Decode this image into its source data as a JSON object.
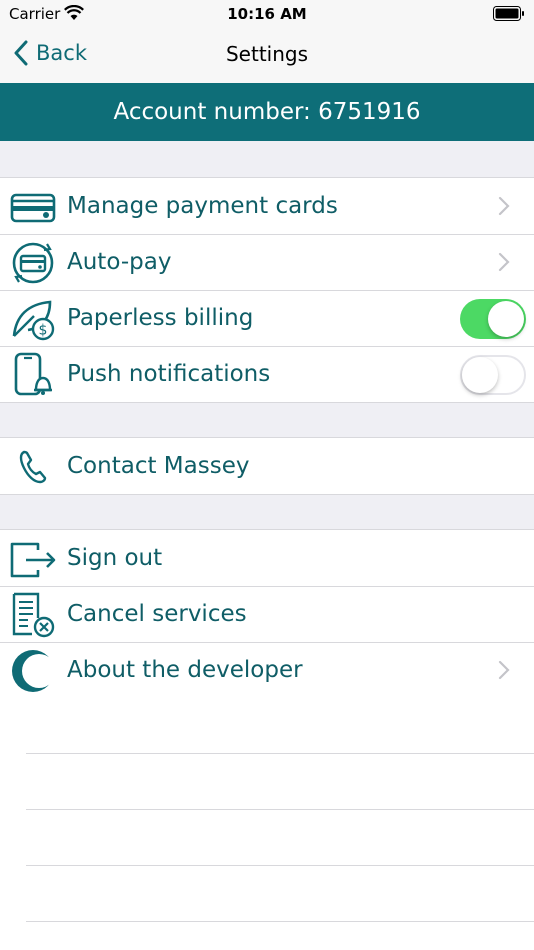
{
  "status_bar": {
    "carrier": "Carrier",
    "time": "10:16 AM"
  },
  "nav": {
    "back_label": "Back",
    "title": "Settings"
  },
  "account": {
    "banner": "Account number: 6751916"
  },
  "groups": [
    {
      "items": [
        {
          "label": "Manage payment cards",
          "icon": "credit-card-icon",
          "accessory": "chevron"
        },
        {
          "label": "Auto-pay",
          "icon": "autopay-icon",
          "accessory": "chevron"
        },
        {
          "label": "Paperless billing",
          "icon": "leaf-dollar-icon",
          "accessory": "toggle",
          "toggle_on": true
        },
        {
          "label": "Push notifications",
          "icon": "phone-bell-icon",
          "accessory": "toggle",
          "toggle_on": false
        }
      ]
    },
    {
      "items": [
        {
          "label": "Contact Massey",
          "icon": "phone-icon",
          "accessory": "none"
        }
      ]
    },
    {
      "items": [
        {
          "label": "Sign out",
          "icon": "sign-out-icon",
          "accessory": "none"
        },
        {
          "label": "Cancel services",
          "icon": "cancel-receipt-icon",
          "accessory": "none"
        },
        {
          "label": "About the developer",
          "icon": "developer-logo-icon",
          "accessory": "chevron"
        }
      ]
    }
  ],
  "colors": {
    "accent": "#0e6e78",
    "text": "#0f5d66",
    "toggle_on": "#4cd964",
    "background": "#efeff4"
  }
}
